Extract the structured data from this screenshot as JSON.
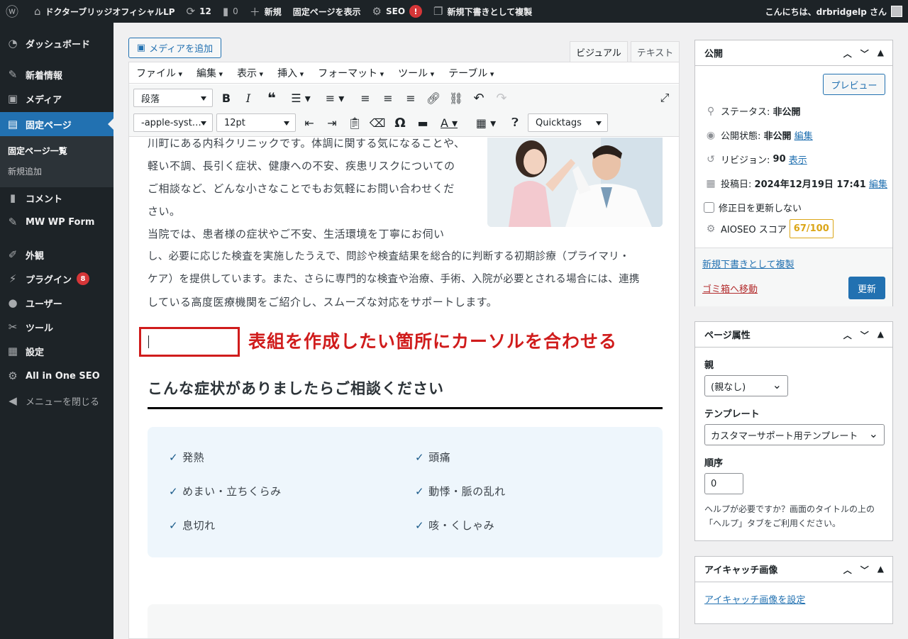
{
  "adminbar": {
    "site_name": "ドクターブリッジオフィシャルLP",
    "updates_count": "12",
    "comments_count": "0",
    "new_label": "新規",
    "view_page": "固定ページを表示",
    "seo_label": "SEO",
    "seo_badge": "!",
    "duplicate_label": "新規下書きとして複製",
    "greeting": "こんにちは、drbridgelp さん"
  },
  "sidebar": {
    "items": [
      {
        "label": "ダッシュボード",
        "icon": "dashboard-icon"
      },
      {
        "label": "新着情報",
        "icon": "pin-icon"
      },
      {
        "label": "メディア",
        "icon": "media-icon"
      },
      {
        "label": "固定ページ",
        "icon": "page-icon"
      },
      {
        "label": "コメント",
        "icon": "comment-icon"
      },
      {
        "label": "MW WP Form",
        "icon": "pin-icon"
      },
      {
        "label": "外観",
        "icon": "brush-icon"
      },
      {
        "label": "プラグイン",
        "icon": "plugin-icon",
        "badge": "8"
      },
      {
        "label": "ユーザー",
        "icon": "user-icon"
      },
      {
        "label": "ツール",
        "icon": "wrench-icon"
      },
      {
        "label": "設定",
        "icon": "settings-icon"
      },
      {
        "label": "All in One SEO",
        "icon": "aioseo-icon"
      }
    ],
    "submenu": [
      "固定ページ一覧",
      "新規追加"
    ],
    "collapse": "メニューを閉じる"
  },
  "editor": {
    "add_media": "メディアを追加",
    "tab_visual": "ビジュアル",
    "tab_text": "テキスト",
    "menus": [
      "ファイル",
      "編集",
      "表示",
      "挿入",
      "フォーマット",
      "ツール",
      "テーブル"
    ],
    "format_select": "段落",
    "font_select": "-apple-syst…",
    "size_select": "12pt",
    "quicktags": "Quicktags",
    "paragraph_lines": [
      "川町にある内科クリニックです。体調に関する気になることや、",
      "軽い不調、長引く症状、健康への不安、疾患リスクについての",
      "ご相談など、どんな小さなことでもお気軽にお問い合わせくだ",
      "さい。",
      "当院では、患者様の症状やご不安、生活環境を丁寧にお伺い",
      "し、必要に応じた検査を実施したうえで、問診や検査結果を総合的に判断する初期診療（プライマリ・",
      "ケア）を提供しています。また、さらに専門的な検査や治療、手術、入院が必要とされる場合には、連携",
      "している高度医療機関をご紹介し、スムーズな対応をサポートします。"
    ],
    "annotation": "表組を作成したい箇所にカーソルを合わせる",
    "heading": "こんな症状がありましたらご相談ください",
    "symptoms": [
      "発熱",
      "頭痛",
      "めまい・立ちくらみ",
      "動悸・脈の乱れ",
      "息切れ",
      "咳・くしゃみ"
    ]
  },
  "publish": {
    "title": "公開",
    "preview": "プレビュー",
    "status_label": "ステータス:",
    "status_value": "非公開",
    "visibility_label": "公開状態:",
    "visibility_value": "非公開",
    "edit": "編集",
    "revision_label": "リビジョン:",
    "revision_value": "90",
    "revision_link": "表示",
    "date_label": "投稿日:",
    "date_value": "2024年12月19日 17:41",
    "no_update_date": "修正日を更新しない",
    "aioseo_label": "AIOSEO スコア",
    "aioseo_score": "67/100",
    "duplicate_link": "新規下書きとして複製",
    "trash": "ゴミ箱へ移動",
    "update": "更新"
  },
  "page_attrs": {
    "title": "ページ属性",
    "parent_label": "親",
    "parent_value": "(親なし)",
    "template_label": "テンプレート",
    "template_value": "カスタマーサポート用テンプレート",
    "order_label": "順序",
    "order_value": "0",
    "help": "ヘルプが必要ですか？画面のタイトルの上の「ヘルプ」タブをご利用ください。"
  },
  "featured": {
    "title": "アイキャッチ画像",
    "set_link": "アイキャッチ画像を設定"
  }
}
